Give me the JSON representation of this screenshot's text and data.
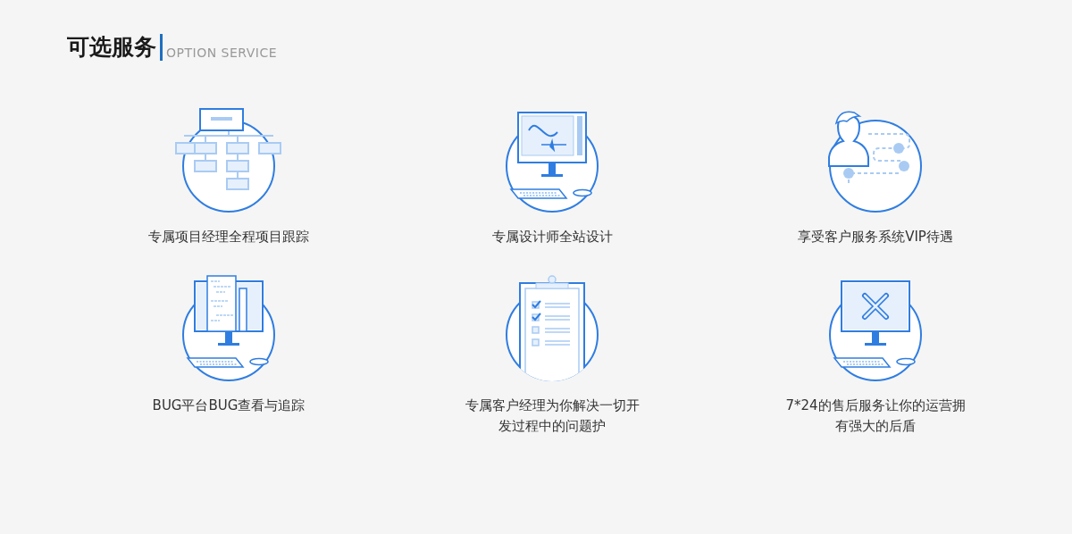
{
  "header": {
    "title": "可选服务",
    "subtitle": "OPTION SERVICE"
  },
  "services": [
    {
      "kind": "org-chart",
      "lines": [
        "专属项目经理全程项目跟踪"
      ]
    },
    {
      "kind": "design-monitor",
      "lines": [
        "专属设计师全站设计"
      ]
    },
    {
      "kind": "customer",
      "lines": [
        "享受客户服务系统VIP待遇"
      ]
    },
    {
      "kind": "code-monitor",
      "lines": [
        "BUG平台BUG查看与追踪"
      ]
    },
    {
      "kind": "clipboard",
      "lines": [
        "专属客户经理为你解决一切开",
        "发过程中的问题护"
      ]
    },
    {
      "kind": "tools-monitor",
      "lines": [
        "7*24的售后服务让你的运营拥",
        "有强大的后盾"
      ]
    }
  ]
}
